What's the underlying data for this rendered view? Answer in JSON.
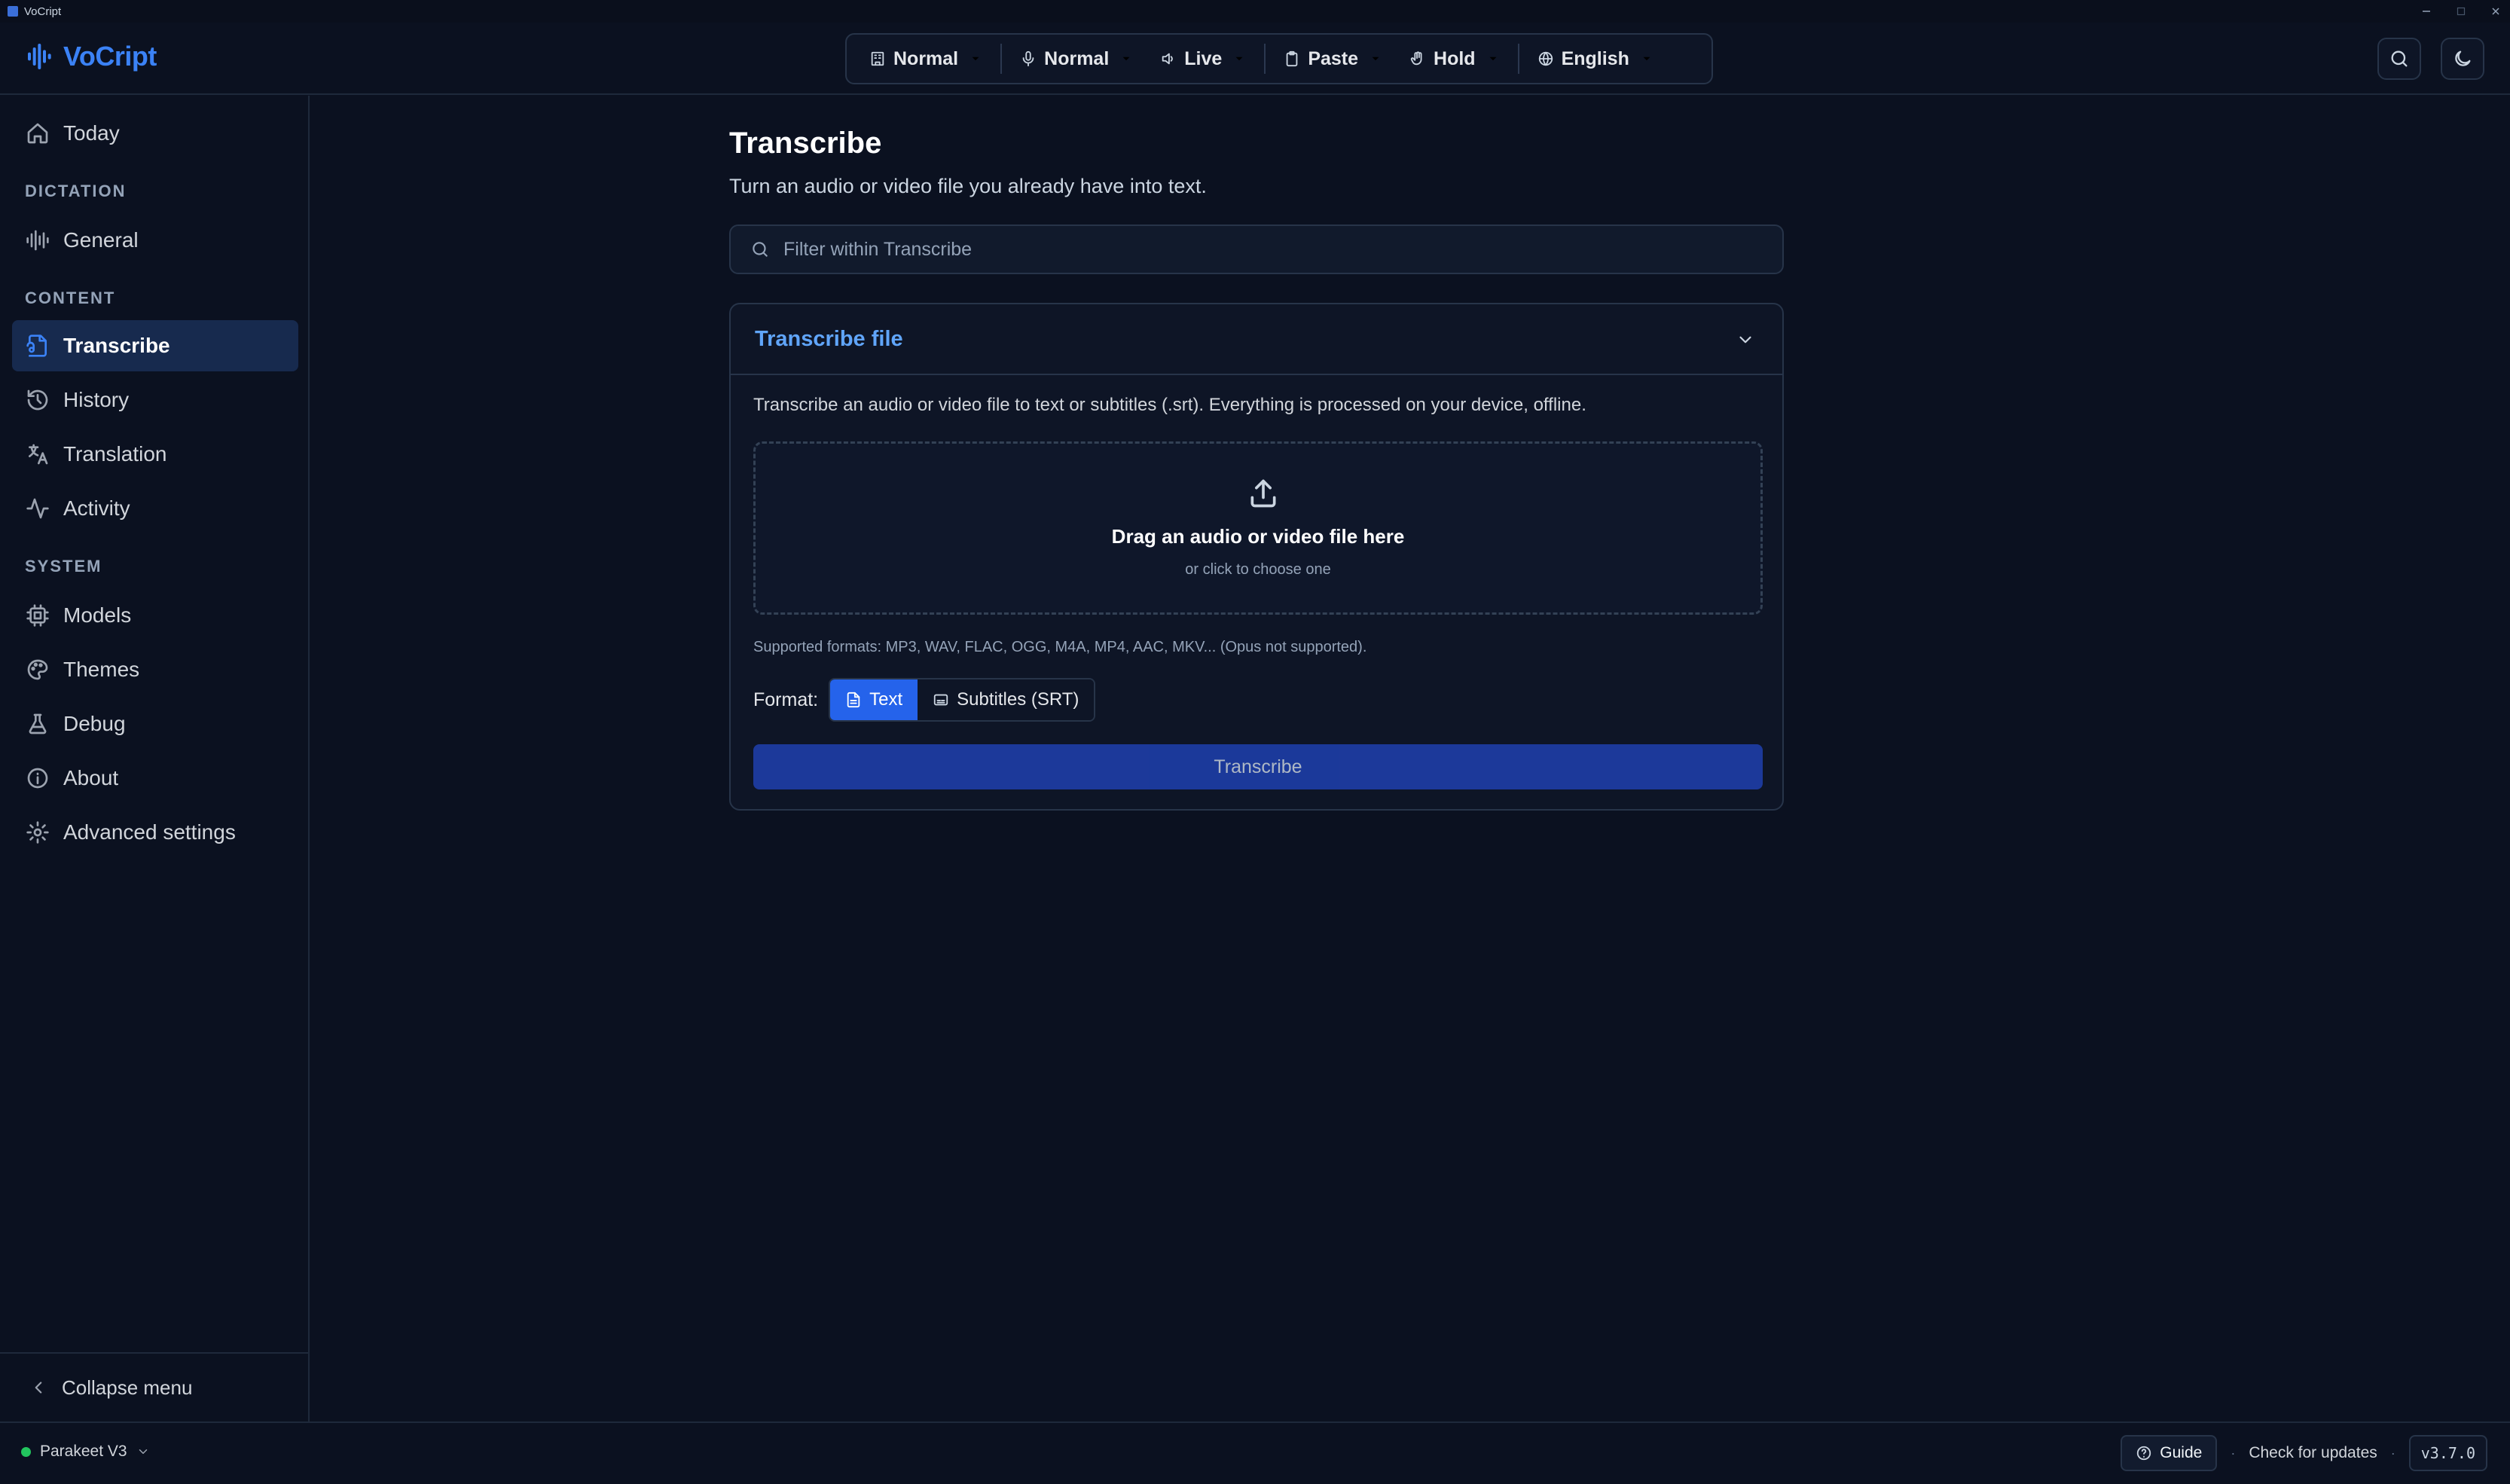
{
  "window": {
    "title": "VoCript"
  },
  "app": {
    "name": "VoCript",
    "accent": "#3b82f6"
  },
  "toolbar": {
    "items": [
      {
        "label": "Normal",
        "icon": "building-icon"
      },
      {
        "label": "Normal",
        "icon": "microphone-icon"
      },
      {
        "label": "Live",
        "icon": "speaker-icon"
      },
      {
        "label": "Paste",
        "icon": "clipboard-icon"
      },
      {
        "label": "Hold",
        "icon": "hand-icon"
      },
      {
        "label": "English",
        "icon": "globe-icon"
      }
    ]
  },
  "header_actions": {
    "search": "search-icon",
    "theme": "moon-icon"
  },
  "sidebar": {
    "today": "Today",
    "sections": {
      "dictation": "DICTATION",
      "content": "CONTENT",
      "system": "SYSTEM"
    },
    "items": {
      "general": "General",
      "transcribe": "Transcribe",
      "history": "History",
      "translation": "Translation",
      "activity": "Activity",
      "models": "Models",
      "themes": "Themes",
      "debug": "Debug",
      "about": "About",
      "advanced": "Advanced settings"
    },
    "active": "Transcribe",
    "collapse": "Collapse menu"
  },
  "main": {
    "title": "Transcribe",
    "subtitle": "Turn an audio or video file you already have into text.",
    "filter_placeholder": "Filter within Transcribe",
    "card": {
      "title": "Transcribe file",
      "description": "Transcribe an audio or video file to text or subtitles (.srt). Everything is processed on your device, offline.",
      "drop_title": "Drag an audio or video file here",
      "drop_sub": "or click to choose one",
      "formats_note": "Supported formats: MP3, WAV, FLAC, OGG, M4A, MP4, AAC, MKV... (Opus not supported).",
      "format_label": "Format:",
      "format_options": [
        "Text",
        "Subtitles (SRT)"
      ],
      "format_selected": "Text",
      "button": "Transcribe"
    }
  },
  "footer": {
    "model": "Parakeet V3",
    "model_status_color": "#22c55e",
    "guide": "Guide",
    "updates": "Check for updates",
    "version": "v3.7.0"
  }
}
